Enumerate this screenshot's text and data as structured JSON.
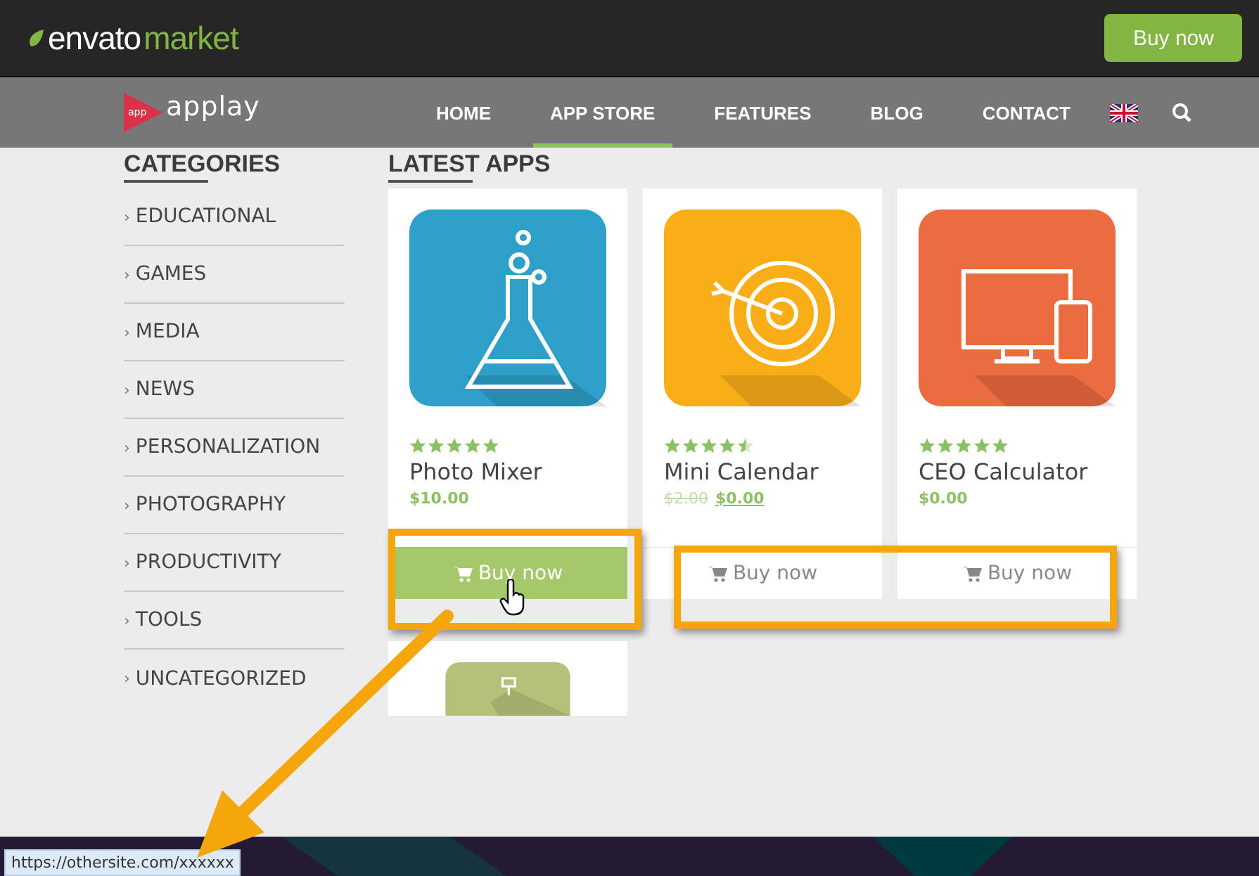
{
  "topbar": {
    "logo_brand": "envato",
    "logo_suffix": "market",
    "button": "Buy now"
  },
  "nav": {
    "logo": "applay",
    "logo_badge": "app",
    "items": [
      {
        "label": "HOME",
        "selected": false
      },
      {
        "label": "APP STORE",
        "selected": true
      },
      {
        "label": "FEATURES",
        "selected": false
      },
      {
        "label": "BLOG",
        "selected": false
      },
      {
        "label": "CONTACT",
        "selected": false
      }
    ]
  },
  "sidebar": {
    "title": "CATEGORIES",
    "marker": "›",
    "items": [
      "EDUCATIONAL",
      "GAMES",
      "MEDIA",
      "NEWS",
      "PERSONALIZATION",
      "PHOTOGRAPHY",
      "PRODUCTIVITY",
      "TOOLS",
      "UNCATEGORIZED"
    ]
  },
  "latest": {
    "title": "LATEST APPS",
    "apps": [
      {
        "kind": "full",
        "color": "#2e9fc9",
        "stars": 5,
        "name": "Photo Mixer",
        "price": "$10.00",
        "button": "Buy now",
        "hovered": true
      },
      {
        "kind": "full",
        "color": "#f9ae17",
        "stars": 4.5,
        "name": "Mini Calendar",
        "old_price": "$2.00",
        "price": "$0.00",
        "button": "Buy now",
        "hovered": false
      },
      {
        "kind": "full",
        "color": "#ec6b40",
        "stars": 5,
        "name": "CEO Calculator",
        "price": "$0.00",
        "button": "Buy now",
        "hovered": false
      },
      {
        "kind": "cut",
        "color": "#b3c17a"
      }
    ]
  },
  "annotations": [
    {
      "kind": "box"
    },
    {
      "kind": "box"
    },
    {
      "kind": "arrow"
    }
  ],
  "status_bar": {
    "url": "https://othersite.com/xxxxxx"
  }
}
